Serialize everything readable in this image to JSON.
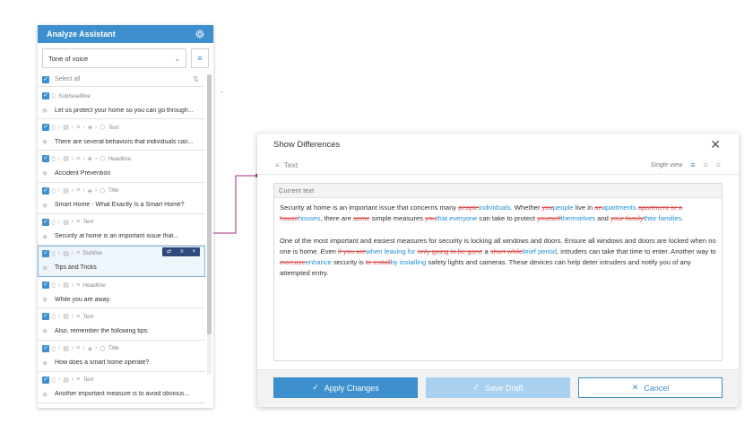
{
  "assistant": {
    "title": "Analyze Assistant",
    "tone_select_value": "Tone of voice",
    "select_all_label": "Select all",
    "items": [
      {
        "crumb": [
          "doc"
        ],
        "label": "Subheadline",
        "text": "Let us protect your home so you can go through..."
      },
      {
        "crumb": [
          "doc",
          "section",
          "list",
          "stack",
          "tag"
        ],
        "label": "Text",
        "text": "There are several behaviors that individuals can..."
      },
      {
        "crumb": [
          "doc",
          "section",
          "list",
          "stack",
          "tag"
        ],
        "label": "Headline",
        "text": "Accident Prevention"
      },
      {
        "crumb": [
          "doc",
          "section",
          "list",
          "stack",
          "tag"
        ],
        "label": "Title",
        "text": "Smart Home - What Exactly Is a Smart Home?"
      },
      {
        "crumb": [
          "doc",
          "section",
          "list"
        ],
        "label": "Text",
        "text": "Security at home is an important issue that..."
      },
      {
        "crumb": [
          "doc",
          "section",
          "list"
        ],
        "label": "Subline",
        "text": "Tips and Tricks",
        "selected": true
      },
      {
        "crumb": [
          "doc",
          "section",
          "list"
        ],
        "label": "Headline",
        "text": "While you are away."
      },
      {
        "crumb": [
          "doc",
          "section",
          "list"
        ],
        "label": "Text",
        "text": "Also, remember the following tips:"
      },
      {
        "crumb": [
          "doc",
          "section",
          "list",
          "stack",
          "tag"
        ],
        "label": "Title",
        "text": "How does a smart home operate?"
      },
      {
        "crumb": [
          "doc",
          "section",
          "list"
        ],
        "label": "Text",
        "text": "Another important measure is to avoid obvious..."
      }
    ]
  },
  "dialog": {
    "title": "Show Differences",
    "subtitle": "Text",
    "view_label": "Single view",
    "current_text_label": "Current text",
    "paragraphs": [
      [
        {
          "t": "Security at home is an important issue that concerns many "
        },
        {
          "d": "people"
        },
        {
          "i": "individuals"
        },
        {
          "t": ". Whether "
        },
        {
          "d": "you"
        },
        {
          "i": "people"
        },
        {
          "t": " live in "
        },
        {
          "d": "an"
        },
        {
          "i": "apartments"
        },
        {
          "t": " "
        },
        {
          "d": "apartment or a house"
        },
        {
          "i": "houses"
        },
        {
          "t": ", there are "
        },
        {
          "d": "some"
        },
        {
          "t": " simple measures "
        },
        {
          "d": "you"
        },
        {
          "i": "that everyone"
        },
        {
          "t": " can take to protect "
        },
        {
          "d": "yourself"
        },
        {
          "i": "themselves"
        },
        {
          "t": " and "
        },
        {
          "d": "your family"
        },
        {
          "i": "their families"
        },
        {
          "t": "."
        }
      ],
      [
        {
          "t": "One of the most important and easiest measures for security is locking all windows and doors. Ensure all windows and doors are locked when no one is home. Even "
        },
        {
          "d": "if you are"
        },
        {
          "i": "when leaving for"
        },
        {
          "t": " "
        },
        {
          "d": "only going to be gone"
        },
        {
          "t": " a "
        },
        {
          "d": "short while"
        },
        {
          "i": "brief period"
        },
        {
          "t": ", intruders can take that time to enter. Another way to "
        },
        {
          "d": "increase"
        },
        {
          "i": "enhance"
        },
        {
          "t": " security is "
        },
        {
          "d": "to install"
        },
        {
          "i": "by installing"
        },
        {
          "t": " safety lights and cameras. These devices can help deter intruders and notify you of any attempted entry."
        }
      ]
    ],
    "buttons": {
      "apply": "Apply Changes",
      "draft": "Save Draft",
      "cancel": "Cancel"
    }
  },
  "colors": {
    "accent": "#3d8fcd",
    "deleted": "#d9534f",
    "inserted": "#1f8fd6",
    "connector": "#a5297f"
  }
}
